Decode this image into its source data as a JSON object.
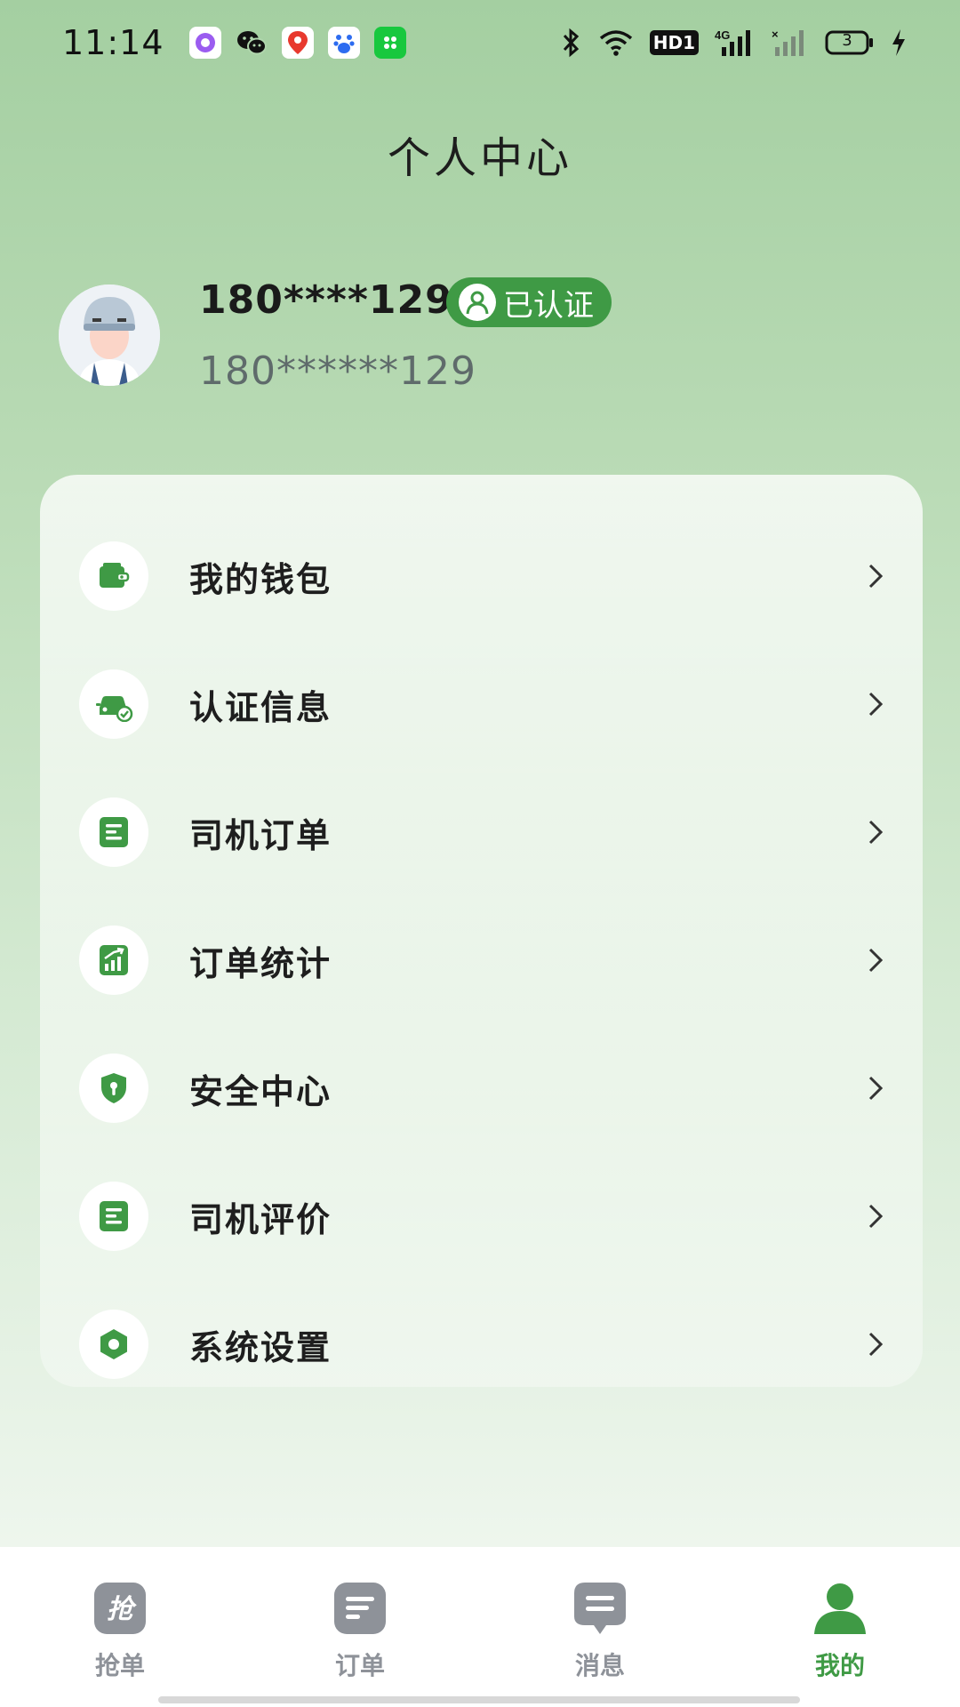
{
  "status_bar": {
    "time": "11:14",
    "apps": [
      "circle-app-icon",
      "wechat-icon",
      "baidu-map-icon",
      "baidu-icon",
      "green-app-icon"
    ],
    "network_hd": "HD1",
    "network_4g": "4G",
    "battery": "3"
  },
  "header": {
    "title": "个人中心"
  },
  "profile": {
    "name": "180****129",
    "badge": "已认证",
    "phone": "180******129"
  },
  "menu": {
    "items": [
      {
        "label": "我的钱包",
        "icon": "wallet-icon"
      },
      {
        "label": "认证信息",
        "icon": "car-verified-icon"
      },
      {
        "label": "司机订单",
        "icon": "document-icon"
      },
      {
        "label": "订单统计",
        "icon": "chart-icon"
      },
      {
        "label": "安全中心",
        "icon": "shield-icon"
      },
      {
        "label": "司机评价",
        "icon": "review-icon"
      },
      {
        "label": "系统设置",
        "icon": "settings-icon"
      }
    ]
  },
  "bottom_nav": {
    "items": [
      {
        "label": "抢单",
        "icon": "grab-order-icon"
      },
      {
        "label": "订单",
        "icon": "orders-icon"
      },
      {
        "label": "消息",
        "icon": "message-icon"
      },
      {
        "label": "我的",
        "icon": "profile-icon",
        "active": true
      }
    ]
  },
  "colors": {
    "accent": "#3f9a45",
    "inactive": "#8e9299",
    "bg_top": "#a4cfa1",
    "bg_bottom": "#eef6ed"
  }
}
